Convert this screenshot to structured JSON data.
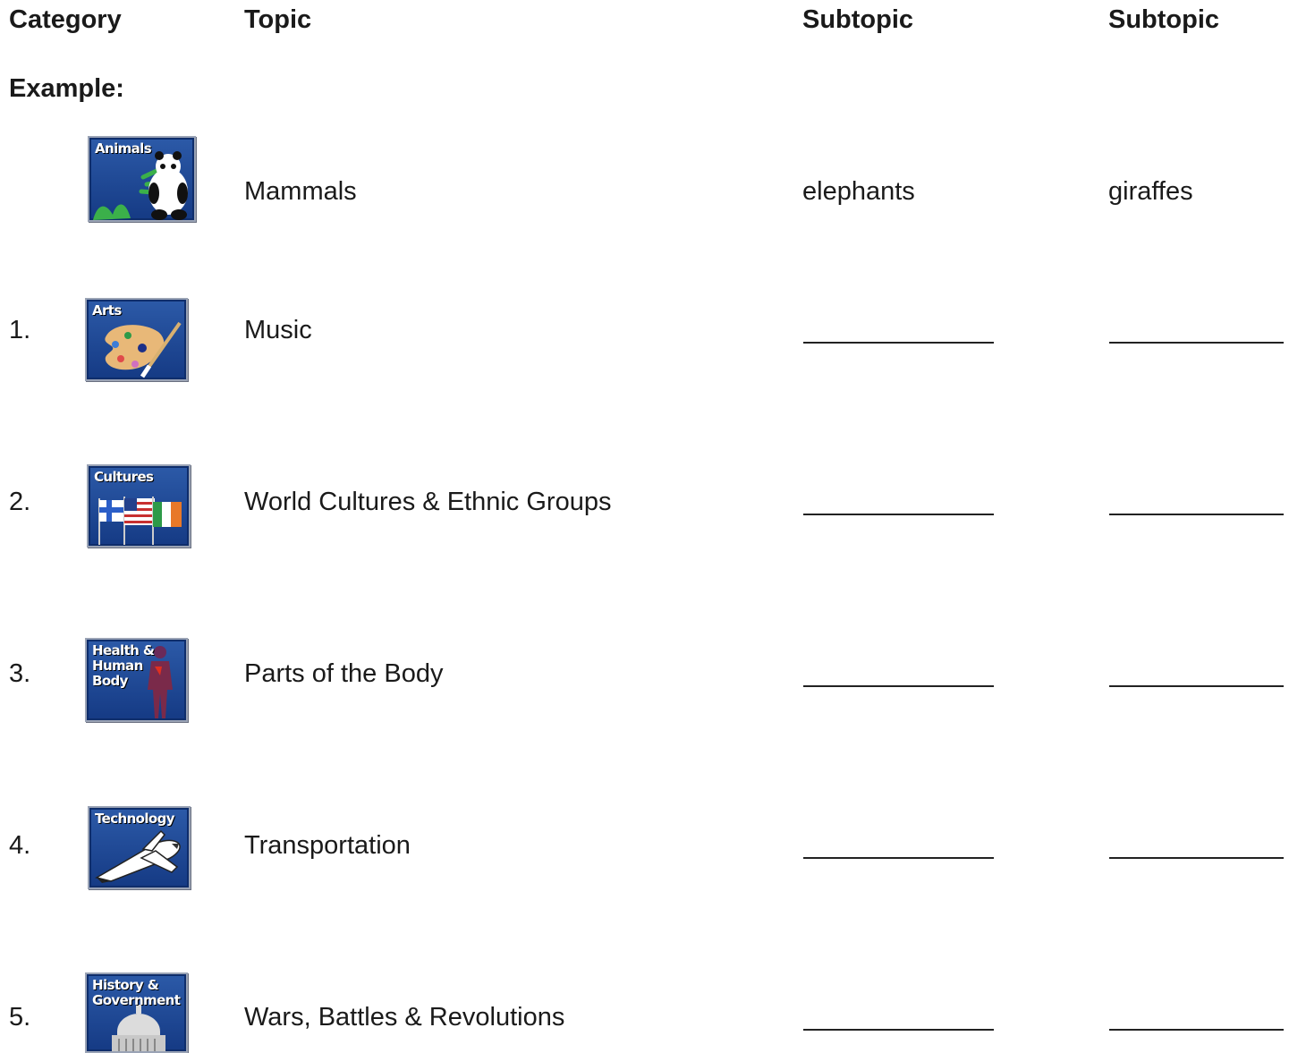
{
  "headers": {
    "category": "Category",
    "topic": "Topic",
    "subtopic1": "Subtopic",
    "subtopic2": "Subtopic"
  },
  "example": {
    "label": "Example:",
    "icon": {
      "name": "animals-icon",
      "label": "Animals"
    },
    "topic": "Mammals",
    "subtopic1": "elephants",
    "subtopic2": "giraffes"
  },
  "rows": [
    {
      "number": "1.",
      "icon": {
        "name": "arts-icon",
        "label": "Arts"
      },
      "topic": "Music"
    },
    {
      "number": "2.",
      "icon": {
        "name": "cultures-icon",
        "label": "Cultures"
      },
      "topic": "World Cultures & Ethnic Groups"
    },
    {
      "number": "3.",
      "icon": {
        "name": "health-human-body-icon",
        "label": "Health &\nHuman\nBody"
      },
      "topic": "Parts of the Body"
    },
    {
      "number": "4.",
      "icon": {
        "name": "technology-icon",
        "label": "Technology"
      },
      "topic": "Transportation"
    },
    {
      "number": "5.",
      "icon": {
        "name": "history-government-icon",
        "label": "History &\nGovernment"
      },
      "topic": "Wars, Battles & Revolutions"
    }
  ]
}
